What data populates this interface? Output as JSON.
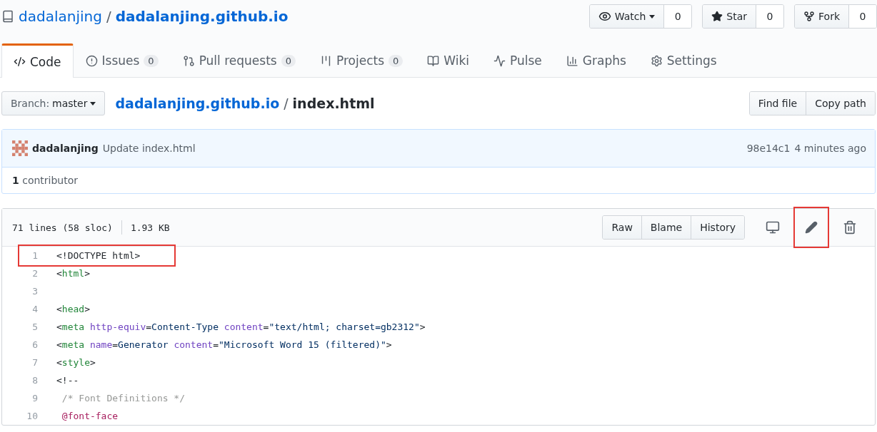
{
  "repo": {
    "owner": "dadalanjing",
    "separator": "/",
    "name": "dadalanjing.github.io"
  },
  "social": [
    {
      "kind": "watch",
      "label": "Watch",
      "count": "0"
    },
    {
      "kind": "star",
      "label": "Star",
      "count": "0"
    },
    {
      "kind": "fork",
      "label": "Fork",
      "count": "0"
    }
  ],
  "tabs": [
    {
      "kind": "code",
      "label": "Code",
      "selected": true
    },
    {
      "kind": "issues",
      "label": "Issues",
      "count": "0",
      "selected": false
    },
    {
      "kind": "pulls",
      "label": "Pull requests",
      "count": "0",
      "selected": false
    },
    {
      "kind": "projects",
      "label": "Projects",
      "count": "0",
      "selected": false
    },
    {
      "kind": "wiki",
      "label": "Wiki",
      "selected": false
    },
    {
      "kind": "pulse",
      "label": "Pulse",
      "selected": false
    },
    {
      "kind": "graphs",
      "label": "Graphs",
      "selected": false
    },
    {
      "kind": "settings",
      "label": "Settings",
      "selected": false
    }
  ],
  "branch": {
    "prefix": "Branch:",
    "name": "master"
  },
  "breadcrumb": {
    "repo": "dadalanjing.github.io",
    "separator": "/",
    "file": "index.html"
  },
  "file_actions": [
    "Find file",
    "Copy path"
  ],
  "commit": {
    "author": "dadalanjing",
    "message": "Update index.html",
    "sha": "98e14c1",
    "time": "4 minutes ago"
  },
  "contributors": {
    "count": "1",
    "label": "contributor"
  },
  "file": {
    "lines": "71 lines (58 sloc)",
    "size": "1.93 KB",
    "buttons": [
      "Raw",
      "Blame",
      "History"
    ],
    "icons": [
      {
        "kind": "desktop",
        "highlighted": false
      },
      {
        "kind": "edit",
        "highlighted": true
      },
      {
        "kind": "delete",
        "highlighted": false
      }
    ]
  },
  "code": [
    {
      "number": "1",
      "highlighted": true,
      "tokens": [
        {
          "kind": "plain",
          "text": "<!DOCTYPE html>"
        }
      ]
    },
    {
      "number": "2",
      "highlighted": false,
      "tokens": [
        {
          "kind": "plain",
          "text": "<"
        },
        {
          "kind": "tag",
          "text": "html"
        },
        {
          "kind": "plain",
          "text": ">"
        }
      ]
    },
    {
      "number": "3",
      "highlighted": false
    },
    {
      "number": "4",
      "highlighted": false,
      "tokens": [
        {
          "kind": "plain",
          "text": "<"
        },
        {
          "kind": "tag",
          "text": "head"
        },
        {
          "kind": "plain",
          "text": ">"
        }
      ]
    },
    {
      "number": "5",
      "highlighted": false,
      "tokens": [
        {
          "kind": "plain",
          "text": "<"
        },
        {
          "kind": "tag",
          "text": "meta"
        },
        {
          "kind": "attr",
          "text": " http-equiv"
        },
        {
          "kind": "plain",
          "text": "="
        },
        {
          "kind": "value",
          "text": "Content-Type"
        },
        {
          "kind": "attr",
          "text": " content"
        },
        {
          "kind": "plain",
          "text": "="
        },
        {
          "kind": "value",
          "text": "\"text/html; charset=gb2312\""
        },
        {
          "kind": "plain",
          "text": ">"
        }
      ]
    },
    {
      "number": "6",
      "highlighted": false,
      "tokens": [
        {
          "kind": "plain",
          "text": "<"
        },
        {
          "kind": "tag",
          "text": "meta"
        },
        {
          "kind": "attr",
          "text": " name"
        },
        {
          "kind": "plain",
          "text": "="
        },
        {
          "kind": "value",
          "text": "Generator"
        },
        {
          "kind": "attr",
          "text": " content"
        },
        {
          "kind": "plain",
          "text": "="
        },
        {
          "kind": "value",
          "text": "\"Microsoft Word 15 (filtered)\""
        },
        {
          "kind": "plain",
          "text": ">"
        }
      ]
    },
    {
      "number": "7",
      "highlighted": false,
      "tokens": [
        {
          "kind": "plain",
          "text": "<"
        },
        {
          "kind": "tag",
          "text": "style"
        },
        {
          "kind": "plain",
          "text": ">"
        }
      ]
    },
    {
      "number": "8",
      "highlighted": false,
      "tokens": [
        {
          "kind": "plain",
          "text": "<!--"
        }
      ]
    },
    {
      "number": "9",
      "highlighted": false,
      "tokens": [
        {
          "kind": "comment",
          "text": " /* Font Definitions */"
        }
      ]
    },
    {
      "number": "10",
      "highlighted": false,
      "tokens": [
        {
          "kind": "atrule",
          "text": " @font-face"
        }
      ]
    }
  ]
}
